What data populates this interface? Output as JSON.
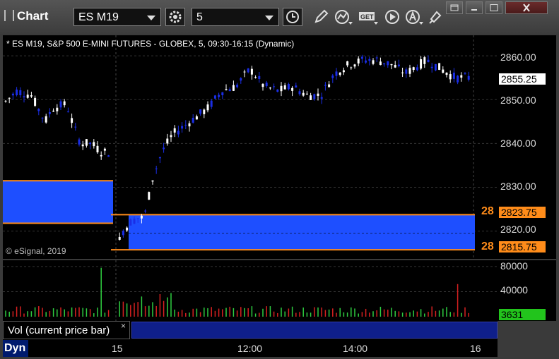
{
  "app": {
    "title": "Chart"
  },
  "toolbar": {
    "symbol": "ES M19",
    "interval": "5",
    "icons": [
      "gear-icon",
      "clock-icon",
      "pencil-icon",
      "study-icon",
      "get-icon",
      "play-icon",
      "alert-icon",
      "paint-icon"
    ]
  },
  "window_controls": [
    "restore-icon",
    "minimize-icon",
    "maximize-icon",
    "close-icon"
  ],
  "chart": {
    "header": "* ES M19, S&P 500 E-MINI FUTURES - GLOBEX, 5, 09:30-16:15 (Dynamic)",
    "copyright": "© eSignal, 2019",
    "price_labels": [
      "2860.00",
      "2850.00",
      "2840.00",
      "2830.00",
      "2820.00"
    ],
    "price_ticks": [
      2860,
      2850,
      2840,
      2830,
      2820
    ],
    "current_price": "2855.25",
    "zone_upper": "2823.75",
    "zone_lower": "2815.75",
    "zone_marker": "28",
    "colors": {
      "zone_fill": "#1e4fff",
      "zone_line": "#ff8c1a",
      "up_candle": "#ffffff",
      "down_candle": "#1a2ee6"
    }
  },
  "volume": {
    "labels": [
      "80000",
      "40000"
    ],
    "current": "3631",
    "colors": {
      "up": "#2ecc40",
      "down": "#d62020",
      "current_bg": "#22c41c"
    }
  },
  "study": {
    "label": "Vol (current price bar)",
    "close": "×"
  },
  "time_axis": {
    "labels": [
      "15",
      "12:00",
      "14:00",
      "16"
    ]
  },
  "status": {
    "dyn": "Dyn"
  },
  "chart_data": {
    "type": "candlestick",
    "title": "* ES M19, S&P 500 E-MINI FUTURES - GLOBEX, 5, 09:30-16:15 (Dynamic)",
    "ylim": [
      2814,
      2865
    ],
    "y_ticks": [
      2820,
      2830,
      2840,
      2850,
      2860
    ],
    "last_price": 2855.25,
    "zones": [
      {
        "upper": 2823.75,
        "lower": 2815.75
      }
    ],
    "volume_ticks": [
      40000,
      80000
    ],
    "last_volume": 3631,
    "x_labels": [
      "15",
      "12:00",
      "14:00",
      "16"
    ]
  }
}
